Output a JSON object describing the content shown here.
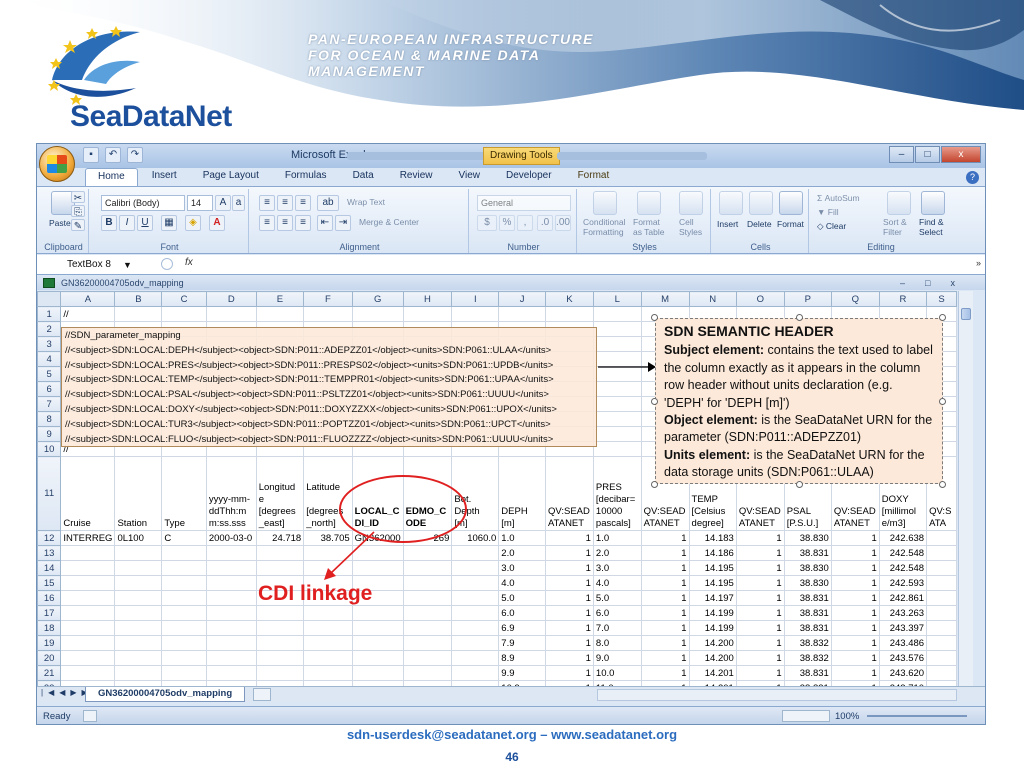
{
  "slide": {
    "banner_line1": "PAN-EUROPEAN INFRASTRUCTURE",
    "banner_line2": "FOR OCEAN & MARINE DATA",
    "banner_line3": "MANAGEMENT",
    "logo_text": "SeaDataNet",
    "footer_contact": "sdn-userdesk@seadatanet.org – www.seadatanet.org",
    "page_number": "46",
    "cdi_label": "CDI linkage"
  },
  "excel": {
    "app_title": "Microsoft Excel",
    "contextual_tab": "Drawing Tools",
    "tabs": [
      "Home",
      "Insert",
      "Page Layout",
      "Formulas",
      "Data",
      "Review",
      "View",
      "Developer",
      "Format"
    ],
    "ribbon": {
      "paste": "Paste",
      "font_name": "Calibri (Body)",
      "font_size": "14",
      "wrap_text": "Wrap Text",
      "merge_center": "Merge & Center",
      "number_format": "General",
      "conditional_formatting_1": "Conditional",
      "conditional_formatting_2": "Formatting",
      "format_as_table_1": "Format",
      "format_as_table_2": "as Table",
      "cell_styles_1": "Cell",
      "cell_styles_2": "Styles",
      "insert": "Insert",
      "delete": "Delete",
      "format": "Format",
      "autosum": "AutoSum",
      "fill": "Fill",
      "clear": "Clear",
      "sort_filter_1": "Sort &",
      "sort_filter_2": "Filter",
      "find_select_1": "Find &",
      "find_select_2": "Select",
      "groups": [
        "Clipboard",
        "Font",
        "Alignment",
        "Number",
        "Styles",
        "Cells",
        "Editing"
      ]
    },
    "name_box": "TextBox 8",
    "fx": "fx",
    "workbook_title": "GN36200004705odv_mapping",
    "sheet_tab": "GN36200004705odv_mapping",
    "status": "Ready",
    "zoom": "100%"
  },
  "grid": {
    "columns": [
      "A",
      "B",
      "C",
      "D",
      "E",
      "F",
      "G",
      "H",
      "I",
      "J",
      "K",
      "L",
      "M",
      "N",
      "O",
      "P",
      "Q",
      "R",
      "S"
    ],
    "row1": "//",
    "row10": "//",
    "code_lines": [
      "//SDN_parameter_mapping",
      "//<subject>SDN:LOCAL:DEPH</subject><object>SDN:P011::ADEPZZ01</object><units>SDN:P061::ULAA</units>",
      "//<subject>SDN:LOCAL:PRES</subject><object>SDN:P011::PRESPS02</object><units>SDN:P061::UPDB</units>",
      "//<subject>SDN:LOCAL:TEMP</subject><object>SDN:P011::TEMPPR01</object><units>SDN:P061::UPAA</units>",
      "//<subject>SDN:LOCAL:PSAL</subject><object>SDN:P011::PSLTZZ01</object><units>SDN:P061::UUUU</units>",
      "//<subject>SDN:LOCAL:DOXY</subject><object>SDN:P011::DOXYZZXX</object><units>SDN:P061::UPOX</units>",
      "//<subject>SDN:LOCAL:TUR3</subject><object>SDN:P011::POPTZZ01</object><units>SDN:P061::UPCT</units>",
      "//<subject>SDN:LOCAL:FLUO</subject><object>SDN:P011::FLUOZZZZ</object><units>SDN:P061::UUUU</units>"
    ],
    "header_row": [
      "Cruise",
      "Station",
      "Type",
      "yyyy-mm-ddThh:mm:ss.sss",
      "Longitude [degrees_east]",
      "Latitude [degrees_north]",
      "LOCAL_CDI_ID",
      "EDMO_CODE",
      "Bot. Depth [m]",
      "DEPH [m]",
      "QV:SEADATANET",
      "PRES [decibar=10000 pascals]",
      "QV:SEADATANET",
      "TEMP [Celsius degree]",
      "QV:SEADATANET",
      "PSAL [P.S.U.]",
      "QV:SEADATANET",
      "DOXY [millimole/m3]",
      "QV:SEADATANET"
    ],
    "header_display": [
      "Cruise",
      "Station",
      "Type",
      "yyyy-mm-\nddThh:m\nm:ss.sss",
      "Longitud\ne\n[degrees\n_east]",
      "Latitude\n\n[degrees\n_north]",
      "LOCAL_C\nDI_ID",
      "EDMO_C\nODE",
      "Bot.\nDepth\n[m]",
      "DEPH [m]",
      "QV:SEAD\nATANET",
      "PRES\n[decibar=\n10000\npascals]",
      "QV:SEAD\nATANET",
      "TEMP\n[Celsius\ndegree]",
      "QV:SEAD\nATANET",
      "PSAL\n[P.S.U.]",
      "QV:SEAD\nATANET",
      "DOXY\n[millimol\ne/m3]",
      "QV:S\nATA"
    ],
    "first_row": [
      "INTERREG",
      "0L100",
      "C",
      "2000-03-0",
      "24.718",
      "38.705",
      "GN362000",
      "269",
      "1060.0"
    ],
    "data_rows": [
      [
        "1.0",
        "1",
        "1.0",
        "1",
        "14.183",
        "1",
        "38.830",
        "1",
        "242.638"
      ],
      [
        "2.0",
        "1",
        "2.0",
        "1",
        "14.186",
        "1",
        "38.831",
        "1",
        "242.548"
      ],
      [
        "3.0",
        "1",
        "3.0",
        "1",
        "14.195",
        "1",
        "38.830",
        "1",
        "242.548"
      ],
      [
        "4.0",
        "1",
        "4.0",
        "1",
        "14.195",
        "1",
        "38.830",
        "1",
        "242.593"
      ],
      [
        "5.0",
        "1",
        "5.0",
        "1",
        "14.197",
        "1",
        "38.831",
        "1",
        "242.861"
      ],
      [
        "6.0",
        "1",
        "6.0",
        "1",
        "14.199",
        "1",
        "38.831",
        "1",
        "243.263"
      ],
      [
        "6.9",
        "1",
        "7.0",
        "1",
        "14.199",
        "1",
        "38.831",
        "1",
        "243.397"
      ],
      [
        "7.9",
        "1",
        "8.0",
        "1",
        "14.200",
        "1",
        "38.832",
        "1",
        "243.486"
      ],
      [
        "8.9",
        "1",
        "9.0",
        "1",
        "14.200",
        "1",
        "38.832",
        "1",
        "243.576"
      ],
      [
        "9.9",
        "1",
        "10.0",
        "1",
        "14.201",
        "1",
        "38.831",
        "1",
        "243.620"
      ],
      [
        "10.9",
        "1",
        "11.0",
        "1",
        "14.201",
        "1",
        "38.831",
        "1",
        "243.710"
      ]
    ]
  },
  "semantic_box": {
    "title": "SDN SEMANTIC HEADER",
    "subject_label": "Subject element:",
    "subject_text": " contains the text used to label the column exactly as it appears in the column row header without units declaration (e.g. 'DEPH'  for 'DEPH [m]')",
    "object_label": "Object element:",
    "object_text": " is the SeaDataNet URN for the parameter (SDN:P011::ADEPZZ01)",
    "units_label": "Units element:",
    "units_text": "  is the SeaDataNet URN  for the data storage units (SDN:P061::ULAA)"
  }
}
